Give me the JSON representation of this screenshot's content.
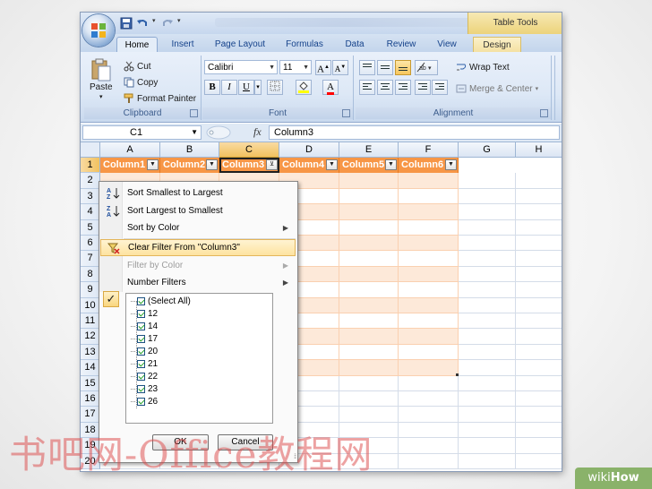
{
  "ribbon": {
    "tabs": [
      "Home",
      "Insert",
      "Page Layout",
      "Formulas",
      "Data",
      "Review",
      "View",
      "Design"
    ],
    "table_tools": "Table Tools",
    "clipboard": {
      "paste": "Paste",
      "cut": "Cut",
      "copy": "Copy",
      "format_painter": "Format Painter",
      "label": "Clipboard"
    },
    "font": {
      "name": "Calibri",
      "size": "11",
      "bold": "B",
      "italic": "I",
      "underline": "U",
      "label": "Font"
    },
    "alignment": {
      "wrap_text": "Wrap Text",
      "merge_center": "Merge & Center",
      "label": "Alignment"
    }
  },
  "formula_bar": {
    "cell_ref": "C1",
    "fx": "fx",
    "value": "Column3"
  },
  "columns": [
    "A",
    "B",
    "C",
    "D",
    "E",
    "F",
    "G",
    "H"
  ],
  "selected_column": "C",
  "rows": [
    "1",
    "2",
    "3",
    "4",
    "5",
    "6",
    "7",
    "8",
    "9",
    "10",
    "11",
    "12",
    "13",
    "14",
    "15",
    "16",
    "17",
    "18",
    "19",
    "20"
  ],
  "table_headers": [
    "Column1",
    "Column2",
    "Column3",
    "Column4",
    "Column5",
    "Column6"
  ],
  "filter_menu": {
    "sort_asc": "Sort Smallest to Largest",
    "sort_desc": "Sort Largest to Smallest",
    "sort_color": "Sort by Color",
    "clear_filter": "Clear Filter From \"Column3\"",
    "filter_color": "Filter by Color",
    "number_filters": "Number Filters",
    "list": [
      "(Select All)",
      "12",
      "14",
      "17",
      "20",
      "21",
      "22",
      "23",
      "26"
    ],
    "ok": "OK",
    "cancel": "Cancel"
  },
  "watermark": "书吧网-Office教程网",
  "badge": {
    "wiki": "wiki",
    "how": "How"
  },
  "colors": {
    "table_header": "#f79646",
    "band": "#fde9d9",
    "ribbon": "#dde8f6",
    "badge": "#8ab26a"
  }
}
